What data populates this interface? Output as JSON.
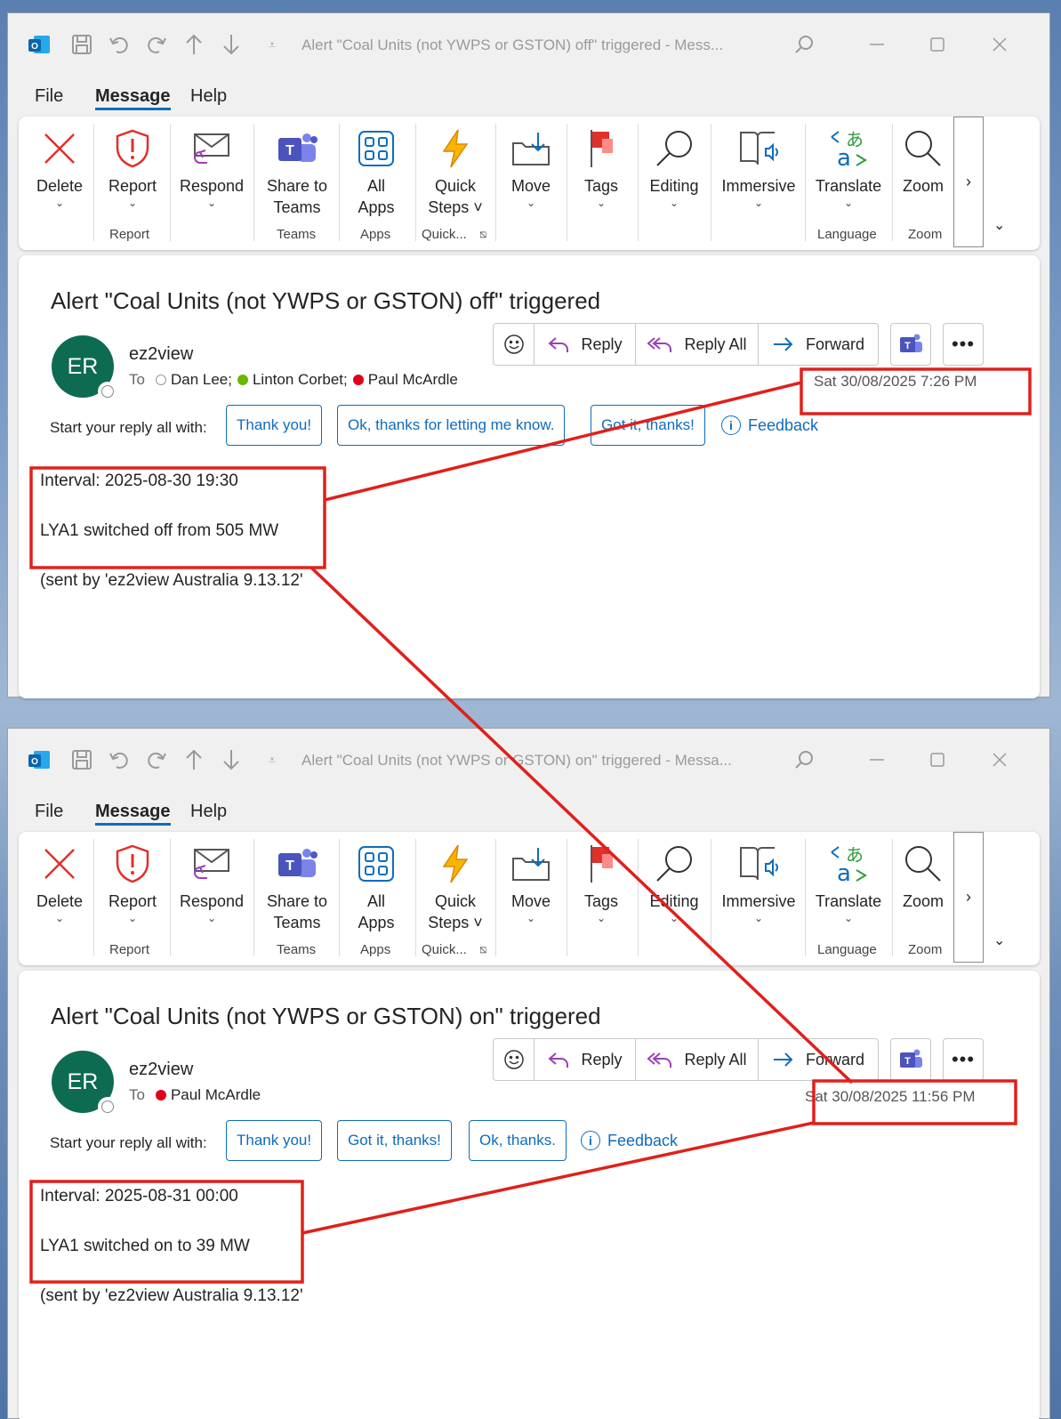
{
  "common": {
    "menu": {
      "file": "File",
      "message": "Message",
      "help": "Help"
    },
    "ribbon": {
      "delete": "Delete",
      "report": "Report",
      "respond": "Respond",
      "share_to_teams": "Share to\nTeams",
      "all_apps": "All\nApps",
      "quick_steps": "Quick\nSteps ˅",
      "move": "Move",
      "tags": "Tags",
      "editing": "Editing",
      "immersive": "Immersive",
      "translate": "Translate",
      "zoom": "Zoom",
      "more": "›",
      "expand": "⌄",
      "groups": {
        "report": "Report",
        "teams": "Teams",
        "apps": "Apps",
        "quick": "Quick...",
        "language": "Language",
        "zoom": "Zoom"
      }
    },
    "actions": {
      "reply": "Reply",
      "reply_all": "Reply All",
      "forward": "Forward"
    },
    "sender_name": "ez2view",
    "avatar_initials": "ER",
    "to_label": "To",
    "reply_prompt": "Start your reply all with:",
    "feedback": "Feedback",
    "signature": "(sent by 'ez2view Australia 9.13.12'",
    "colors": {
      "accent": "#0f6cbd",
      "avatar": "#0d6b51",
      "annotation": "#e0201b"
    }
  },
  "email1": {
    "window_title": "Alert \"Coal Units (not YWPS or GSTON) off\" triggered  -  Mess...",
    "subject": "Alert \"Coal Units (not YWPS or GSTON) off\" triggered",
    "recipients": [
      {
        "name": "Dan Lee;",
        "status": "offline"
      },
      {
        "name": "Linton Corbet;",
        "status": "available"
      },
      {
        "name": "Paul McArdle",
        "status": "busy"
      }
    ],
    "date": "Sat 30/08/2025 7:26 PM",
    "suggestions": [
      "Thank you!",
      "Ok, thanks for letting me know.",
      "Got it, thanks!"
    ],
    "body": {
      "interval": "Interval: 2025-08-30 19:30",
      "event": "LYA1 switched off from 505 MW"
    }
  },
  "email2": {
    "window_title": "Alert \"Coal Units (not YWPS or GSTON) on\" triggered  -  Messa...",
    "subject": "Alert \"Coal Units (not YWPS or GSTON) on\" triggered",
    "recipients": [
      {
        "name": "Paul McArdle",
        "status": "busy"
      }
    ],
    "date": "Sat 30/08/2025 11:56 PM",
    "suggestions": [
      "Thank you!",
      "Got it, thanks!",
      "Ok, thanks."
    ],
    "body": {
      "interval": "Interval: 2025-08-31 00:00",
      "event": "LYA1 switched on to 39 MW"
    }
  }
}
